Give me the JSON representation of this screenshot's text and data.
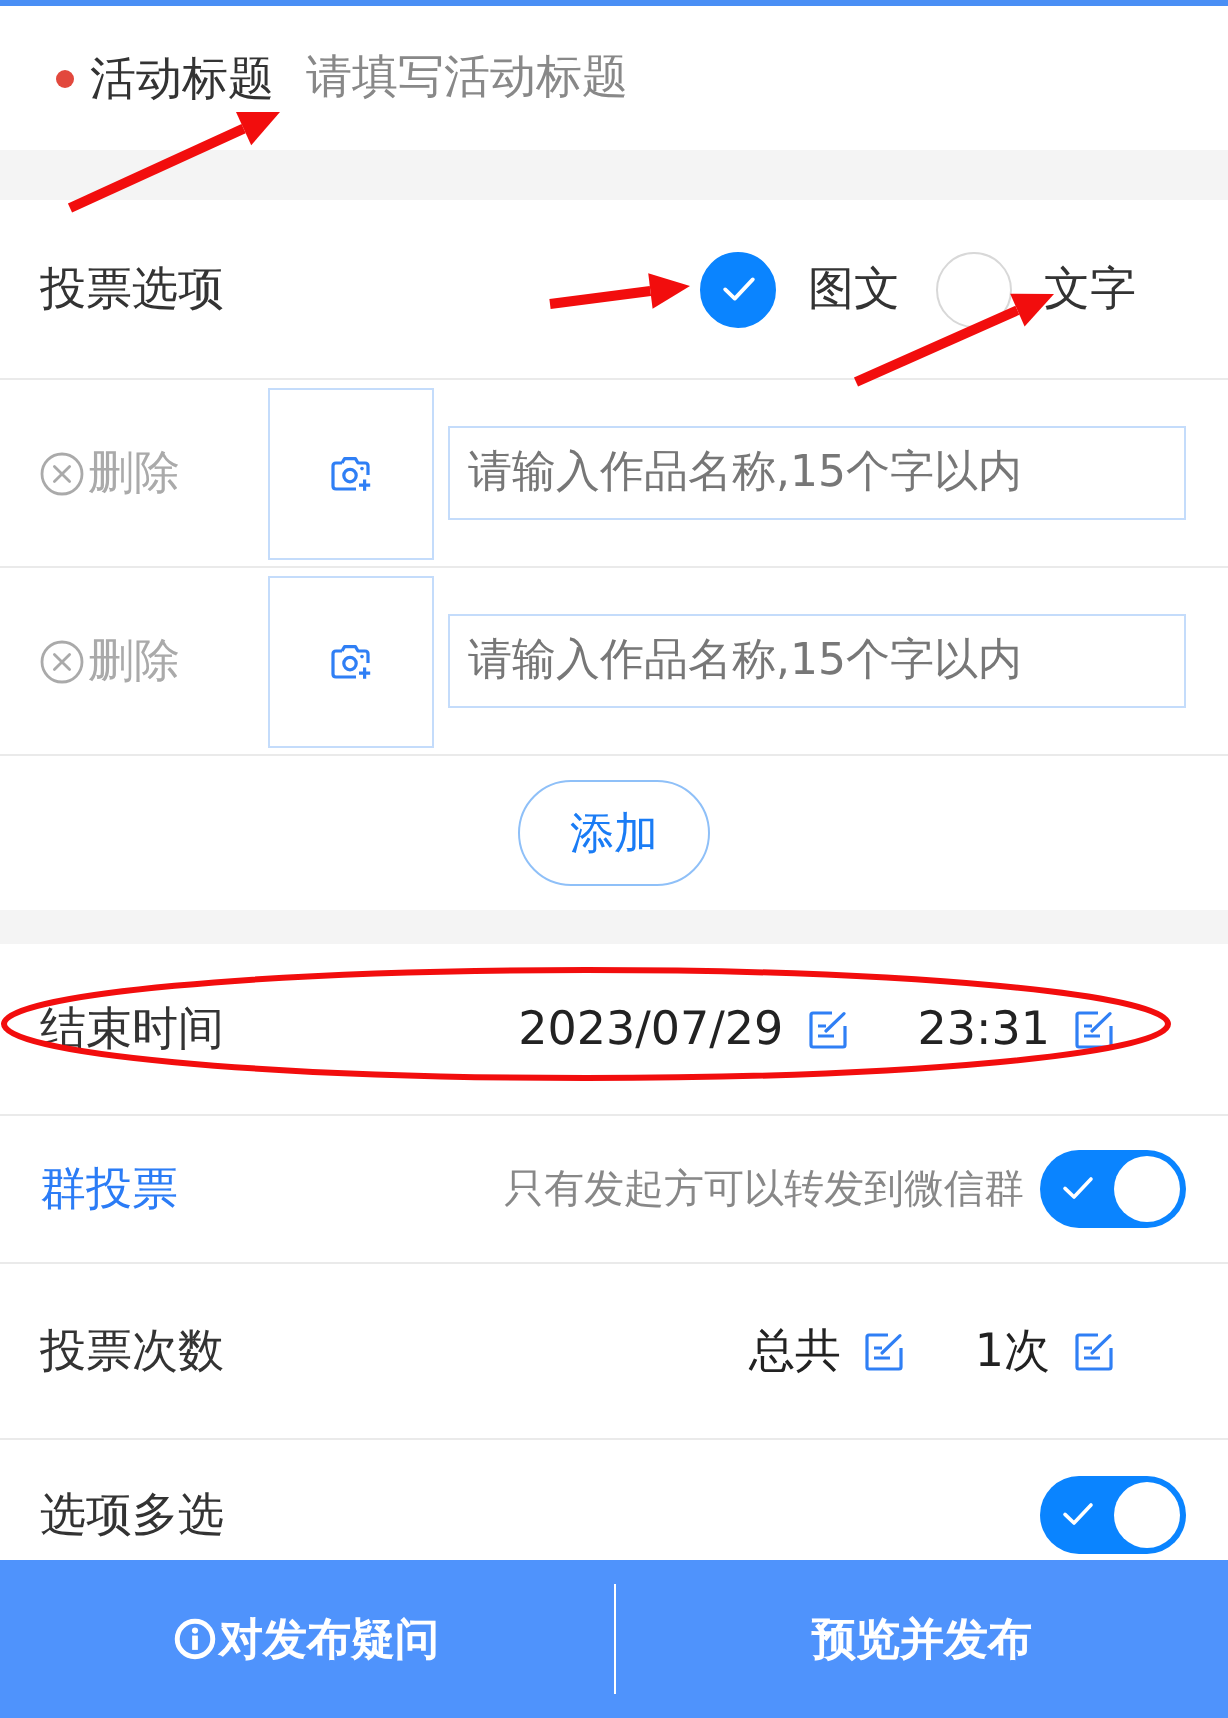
{
  "title_field": {
    "label": "活动标题",
    "required": true,
    "placeholder": "请填写活动标题"
  },
  "vote_options": {
    "label": "投票选项",
    "types": [
      {
        "label": "图文",
        "selected": true
      },
      {
        "label": "文字",
        "selected": false
      }
    ]
  },
  "options": [
    {
      "delete": "删除",
      "placeholder": "请输入作品名称,15个字以内"
    },
    {
      "delete": "删除",
      "placeholder": "请输入作品名称,15个字以内"
    }
  ],
  "add_button": "添加",
  "end_time": {
    "label": "结束时间",
    "date": "2023/07/29",
    "time": "23:31"
  },
  "group_vote": {
    "label": "群投票",
    "hint": "只有发起方可以转发到微信群",
    "on": true
  },
  "vote_count": {
    "label": "投票次数",
    "scope": "总共",
    "count": "1次"
  },
  "multi_select": {
    "label": "选项多选",
    "on": true
  },
  "bottom_bar": {
    "help": "对发布疑问",
    "publish": "预览并发布"
  }
}
